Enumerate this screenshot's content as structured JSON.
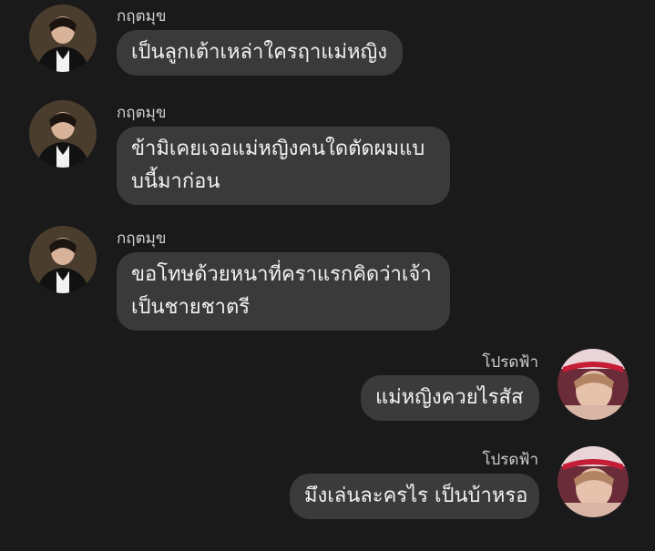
{
  "messages": [
    {
      "side": "left",
      "sender": "กฤตมุข",
      "lines": [
        "เป็นลูกเต้าเหล่าใครฤาแม่หญิง"
      ]
    },
    {
      "side": "left",
      "sender": "กฤตมุข",
      "lines": [
        "ข้ามิเคยเจอแม่หญิงคนใดตัดผมแบ",
        "บนี้มาก่อน"
      ]
    },
    {
      "side": "left",
      "sender": "กฤตมุข",
      "lines": [
        "ขอโทษด้วยหนาที่คราแรกคิดว่าเจ้า",
        "เป็นชายชาตรี"
      ]
    },
    {
      "side": "right",
      "sender": "โปรดฟ้า",
      "lines": [
        "แม่หญิงควยไรสัส"
      ]
    },
    {
      "side": "right",
      "sender": "โปรดฟ้า",
      "lines": [
        "มึงเล่นละครไร เป็นบ้าหรอ"
      ]
    }
  ],
  "colors": {
    "background": "#1a1a1a",
    "bubble": "#3a3a3a",
    "text": "#f2f2f2",
    "sender": "#cfcfcf"
  }
}
